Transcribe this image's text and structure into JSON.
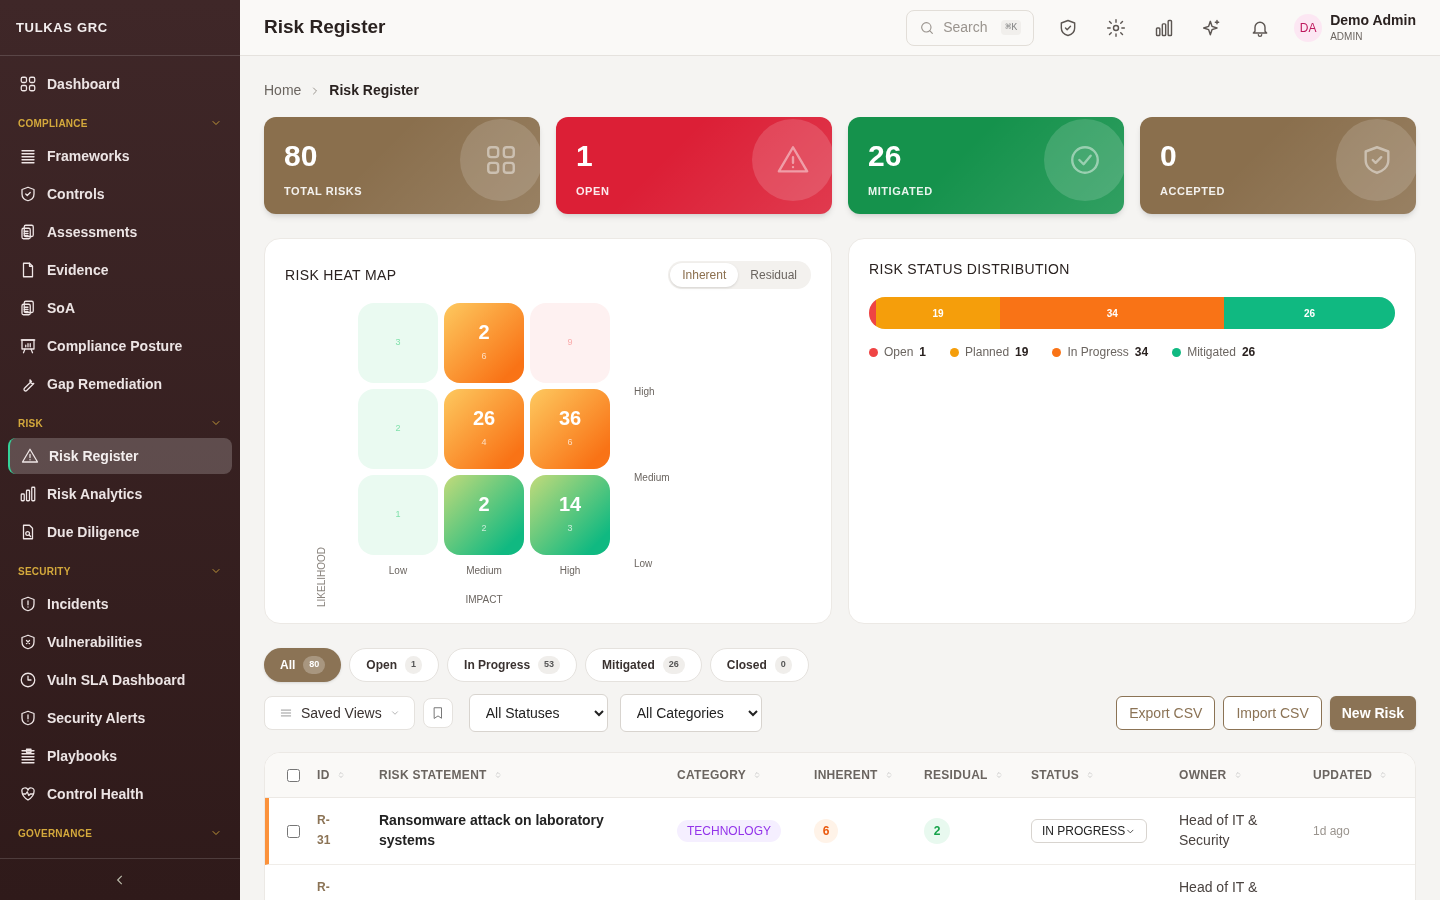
{
  "brand": "TULKAS GRC",
  "sidebar": {
    "top": [
      {
        "label": "Dashboard",
        "selected": false
      }
    ],
    "sections": [
      {
        "title": "COMPLIANCE",
        "expanded": true,
        "items": [
          {
            "label": "Frameworks",
            "selected": false
          },
          {
            "label": "Controls",
            "selected": false
          },
          {
            "label": "Assessments",
            "selected": false
          },
          {
            "label": "Evidence",
            "selected": false
          },
          {
            "label": "SoA",
            "selected": false
          },
          {
            "label": "Compliance Posture",
            "selected": false
          },
          {
            "label": "Gap Remediation",
            "selected": false
          }
        ]
      },
      {
        "title": "RISK",
        "expanded": true,
        "items": [
          {
            "label": "Risk Register",
            "selected": true
          },
          {
            "label": "Risk Analytics",
            "selected": false
          },
          {
            "label": "Due Diligence",
            "selected": false
          }
        ]
      },
      {
        "title": "SECURITY",
        "expanded": true,
        "items": [
          {
            "label": "Incidents",
            "selected": false
          },
          {
            "label": "Vulnerabilities",
            "selected": false
          },
          {
            "label": "Vuln SLA Dashboard",
            "selected": false
          },
          {
            "label": "Security Alerts",
            "selected": false
          },
          {
            "label": "Playbooks",
            "selected": false
          },
          {
            "label": "Control Health",
            "selected": false
          }
        ]
      },
      {
        "title": "GOVERNANCE",
        "expanded": true
      }
    ]
  },
  "header": {
    "title": "Risk Register",
    "search": {
      "placeholder": "Search",
      "shortcut": "⌘K"
    },
    "user": {
      "initials": "DA",
      "name": "Demo Admin",
      "role": "ADMIN"
    }
  },
  "breadcrumb": [
    {
      "label": "Home",
      "current": false
    },
    {
      "label": "Risk Register",
      "current": true
    }
  ],
  "stats": [
    {
      "value": "80",
      "label": "TOTAL RISKS",
      "color": "#8a6f4d"
    },
    {
      "value": "1",
      "label": "OPEN",
      "color": "#dc1f36"
    },
    {
      "value": "26",
      "label": "MITIGATED",
      "color": "#15924c"
    },
    {
      "value": "0",
      "label": "ACCEPTED",
      "color": "#8a6f4d"
    }
  ],
  "heat_map": {
    "title": "RISK HEAT MAP",
    "toggle": [
      {
        "label": "Inherent",
        "selected": true
      },
      {
        "label": "Residual",
        "selected": false
      }
    ],
    "rows": [
      [
        {
          "color": "#eafaf1",
          "count": "3"
        },
        {
          "color": "#f97316",
          "count": "2",
          "sub": "6"
        },
        {
          "color": "#fef1f1",
          "count": "9"
        }
      ],
      [
        {
          "color": "#eafaf1",
          "count": "2"
        },
        {
          "color": "#f97316",
          "count": "26",
          "sub": "4"
        },
        {
          "color": "#f97316",
          "count": "36",
          "sub": "6"
        }
      ],
      [
        {
          "color": "#eafaf1",
          "count": "1"
        },
        {
          "color": "#10b981",
          "count": "2",
          "sub": "2"
        },
        {
          "color": "#10b981",
          "count": "14",
          "sub": "3"
        }
      ]
    ],
    "x_labels": [
      "Low",
      "Medium",
      "High"
    ],
    "y_labels": [
      "High",
      "Medium",
      "Low"
    ],
    "x_title": "IMPACT",
    "y_title": "LIKELIHOOD"
  },
  "distribution": {
    "title": "RISK STATUS DISTRIBUTION",
    "segments": [
      {
        "color": "#ef4444"
      },
      {
        "label": "19",
        "color": "#f59e0b"
      },
      {
        "label": "34",
        "color": "#f97316"
      },
      {
        "label": "26",
        "color": "#10b981"
      }
    ],
    "legend": [
      {
        "label": "Open",
        "count": "1",
        "color": "#ef4444"
      },
      {
        "label": "Planned",
        "count": "19",
        "color": "#f59e0b"
      },
      {
        "label": "In Progress",
        "count": "34",
        "color": "#f97316"
      },
      {
        "label": "Mitigated",
        "count": "26",
        "color": "#10b981"
      }
    ]
  },
  "filter_tabs": [
    {
      "label": "All",
      "count": "80",
      "selected": true
    },
    {
      "label": "Open",
      "count": "1",
      "selected": false
    },
    {
      "label": "In Progress",
      "count": "53",
      "selected": false
    },
    {
      "label": "Mitigated",
      "count": "26",
      "selected": false
    },
    {
      "label": "Closed",
      "count": "0",
      "selected": false
    }
  ],
  "toolbar": {
    "saved_views": "Saved Views",
    "status_filter": "All Statuses",
    "category_filter": "All Categories",
    "actions": [
      {
        "label": "Export CSV",
        "kind": "outline"
      },
      {
        "label": "Import CSV",
        "kind": "outline"
      },
      {
        "label": "New Risk",
        "kind": "primary"
      }
    ]
  },
  "table": {
    "select_all_checked": false,
    "columns": [
      "ID",
      "RISK STATEMENT",
      "CATEGORY",
      "INHERENT",
      "RESIDUAL",
      "STATUS",
      "OWNER",
      "UPDATED"
    ],
    "rows": [
      {
        "id": "R-\n31",
        "statement": "Ransomware attack on laboratory systems",
        "category": "TECHNOLOGY",
        "inherent": "6",
        "residual": "2",
        "status": "IN PROGRESS",
        "owner": "Head of IT & Security",
        "updated": "1d ago",
        "checked": false,
        "highlighted": true
      },
      {
        "id": "R-",
        "owner": "Head of IT &",
        "highlighted": false
      }
    ]
  }
}
